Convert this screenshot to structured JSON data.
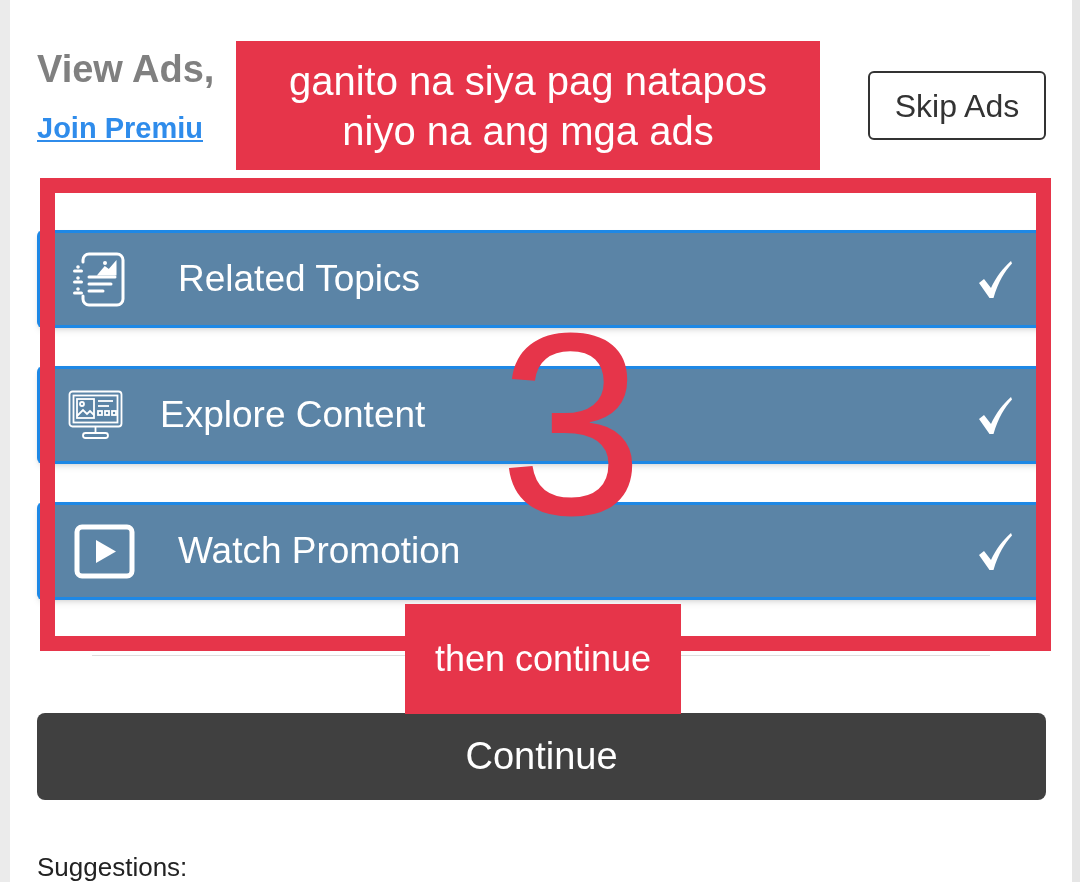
{
  "header": {
    "title": "View Ads,",
    "premium_link": "Join Premiu",
    "skip_button": "Skip Ads"
  },
  "tasks": [
    {
      "kind": "topics",
      "label": "Related Topics",
      "completed": true
    },
    {
      "kind": "content",
      "label": "Explore Content",
      "completed": true
    },
    {
      "kind": "video",
      "label": "Watch Promotion",
      "completed": true
    }
  ],
  "continue_button": "Continue",
  "suggestions_label": "Suggestions:",
  "annotations": {
    "caption_lines": [
      "ganito na siya pag natapos",
      "niyo na ang mga ads"
    ],
    "step_number": "3",
    "note": "then continue"
  }
}
